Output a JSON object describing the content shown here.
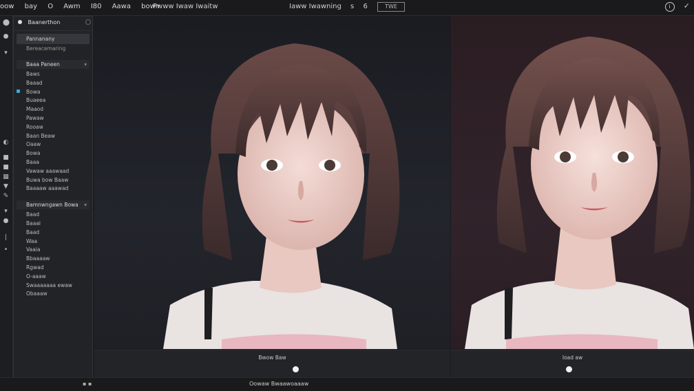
{
  "topbar": {
    "menu": [
      "oow",
      "bay",
      "O",
      "Awm",
      "I80",
      "Aawa",
      "bown"
    ],
    "center_text": "Pwww Iwaw Iwaitw",
    "right_text": "Iaww Iwawning",
    "right_text_suffix": "s",
    "right_icon": "6",
    "box_label": "TWE"
  },
  "sidebar": {
    "header": "Baanerthon",
    "tab": "Pannanany",
    "sub": "Bereacemaring",
    "section1": "Baaa Paneen",
    "items1": [
      "Baws",
      "Baaad",
      "Bowa",
      "Buaeea",
      "Maaod",
      "Pawaw",
      "Rooaw",
      "Baan Beaw",
      "Oaaw",
      "Bowa",
      "Baaa",
      "Vawaw aaawaad",
      "Buwa bow Baaw",
      "Baaaaw aaawad"
    ],
    "section2": "Bamnwngawn Bowa",
    "items2": [
      "Baad",
      "Baaal",
      "Baad",
      "Waa",
      "Vaaia",
      "Bbaaaaw",
      "Rgwad",
      "O-aaaw",
      "Swaaaaaaa ewaw",
      "Obaaaw"
    ]
  },
  "captions": {
    "left": "Bwow Baw",
    "right": "Ioad aw"
  },
  "status": {
    "text": "Oowaw Bwaawoaaaw",
    "marks": "▪ ▪"
  },
  "colors": {
    "accent": "#3ea8e0",
    "left_panel_bg": "#1f2127",
    "right_panel_bg": "#2e2127"
  }
}
